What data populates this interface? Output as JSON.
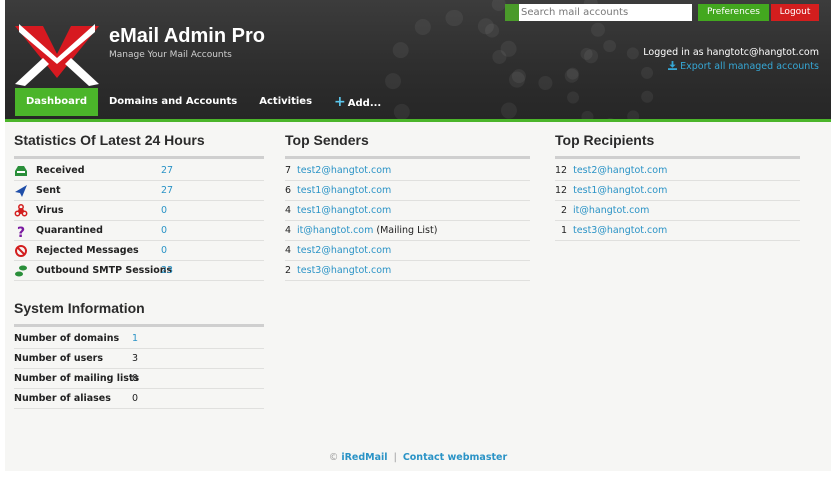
{
  "header": {
    "app_title": "eMail Admin Pro",
    "app_tagline": "Manage Your Mail Accounts",
    "search_placeholder": "Search mail accounts",
    "preferences_label": "Preferences",
    "logout_label": "Logout",
    "logged_in_text": "Logged in as hangtotc@hangtot.com",
    "export_label": "Export all managed accounts"
  },
  "nav": {
    "items": [
      {
        "label": "Dashboard",
        "active": true
      },
      {
        "label": "Domains and Accounts"
      },
      {
        "label": "Activities"
      },
      {
        "label": "Add...",
        "icon": "plus-icon"
      }
    ]
  },
  "stats": {
    "title": "Statistics Of Latest 24 Hours",
    "rows": [
      {
        "label": "Received",
        "value": "27",
        "icon": "received-icon"
      },
      {
        "label": "Sent",
        "value": "27",
        "icon": "sent-icon"
      },
      {
        "label": "Virus",
        "value": "0",
        "icon": "virus-icon"
      },
      {
        "label": "Quarantined",
        "value": "0",
        "icon": "quarantine-icon"
      },
      {
        "label": "Rejected Messages",
        "value": "0",
        "icon": "rejected-icon"
      },
      {
        "label": "Outbound SMTP Sessions",
        "value": "23",
        "icon": "smtp-icon"
      }
    ]
  },
  "system": {
    "title": "System Information",
    "rows": [
      {
        "label": "Number of domains",
        "value": "1",
        "linked": true
      },
      {
        "label": "Number of users",
        "value": "3"
      },
      {
        "label": "Number of mailing lists",
        "value": "0"
      },
      {
        "label": "Number of aliases",
        "value": "0"
      }
    ]
  },
  "senders": {
    "title": "Top Senders",
    "rows": [
      {
        "count": "7",
        "address": "test2@hangtot.com",
        "note": ""
      },
      {
        "count": "6",
        "address": "test1@hangtot.com",
        "note": ""
      },
      {
        "count": "4",
        "address": "test1@hangtot.com",
        "note": ""
      },
      {
        "count": "4",
        "address": "it@hangtot.com",
        "note": "(Mailing List)"
      },
      {
        "count": "4",
        "address": "test2@hangtot.com",
        "note": ""
      },
      {
        "count": "2",
        "address": "test3@hangtot.com",
        "note": ""
      }
    ]
  },
  "recipients": {
    "title": "Top Recipients",
    "rows": [
      {
        "count": "12",
        "address": "test2@hangtot.com"
      },
      {
        "count": "12",
        "address": "test1@hangtot.com"
      },
      {
        "count": "2",
        "address": "it@hangtot.com"
      },
      {
        "count": "1",
        "address": "test3@hangtot.com"
      }
    ]
  },
  "footer": {
    "copyright": "©",
    "product_link": "iRedMail",
    "separator": "|",
    "contact_link": "Contact webmaster"
  },
  "colors": {
    "accent_green": "#4bb52a",
    "logout_red": "#d31e1e",
    "link_blue": "#2a93c6"
  }
}
